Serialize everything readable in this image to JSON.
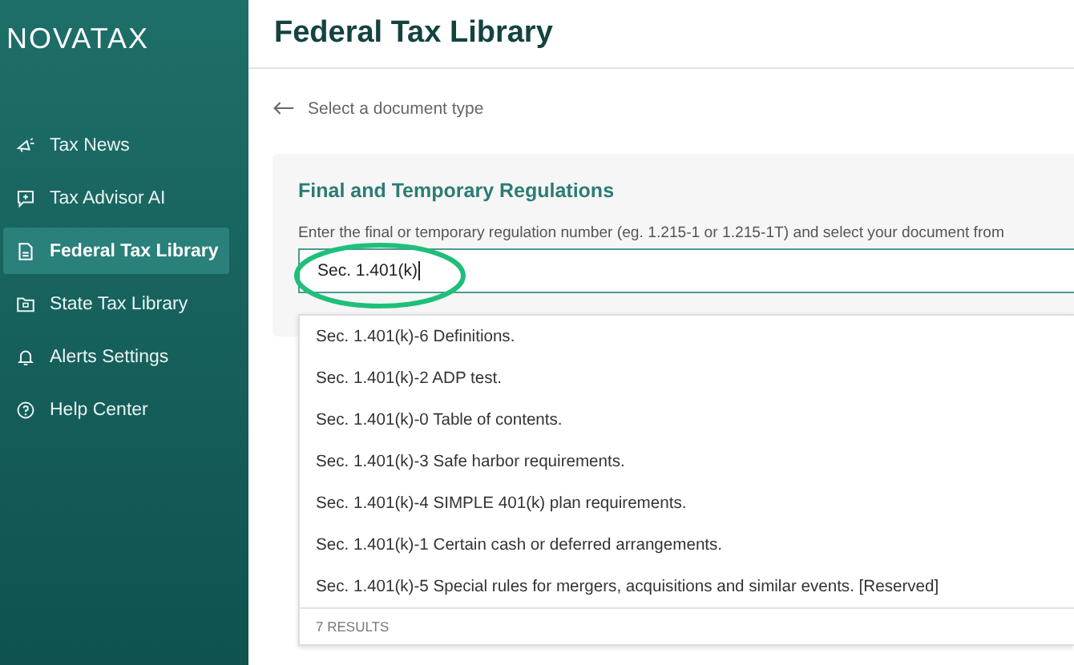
{
  "sidebar": {
    "logo": "NOVATAX",
    "items": [
      {
        "label": "Tax News",
        "selected": false
      },
      {
        "label": "Tax Advisor AI",
        "selected": false
      },
      {
        "label": "Federal Tax Library",
        "selected": true
      },
      {
        "label": "State Tax Library",
        "selected": false
      },
      {
        "label": "Alerts Settings",
        "selected": false
      },
      {
        "label": "Help Center",
        "selected": false
      }
    ]
  },
  "header": {
    "title": "Federal Tax Library"
  },
  "back_link": "Select a document type",
  "card": {
    "title": "Final and Temporary Regulations",
    "hint": "Enter the final or temporary regulation number (eg. 1.215-1 or 1.215-1T) and select your document from",
    "search": {
      "value": "Sec. 1.401(k)",
      "highlighted": true
    },
    "results": [
      {
        "label": "Sec. 1.401(k)-6 Definitions."
      },
      {
        "label": "Sec. 1.401(k)-2 ADP test."
      },
      {
        "label": "Sec. 1.401(k)-0 Table of contents."
      },
      {
        "label": "Sec. 1.401(k)-3 Safe harbor requirements."
      },
      {
        "label": "Sec. 1.401(k)-4 SIMPLE 401(k) plan requirements."
      },
      {
        "label": "Sec. 1.401(k)-1 Certain cash or deferred arrangements."
      },
      {
        "label": "Sec. 1.401(k)-5 Special rules for mergers, acquisitions and similar events. [Reserved]"
      }
    ],
    "result_count": "7 RESULTS"
  }
}
